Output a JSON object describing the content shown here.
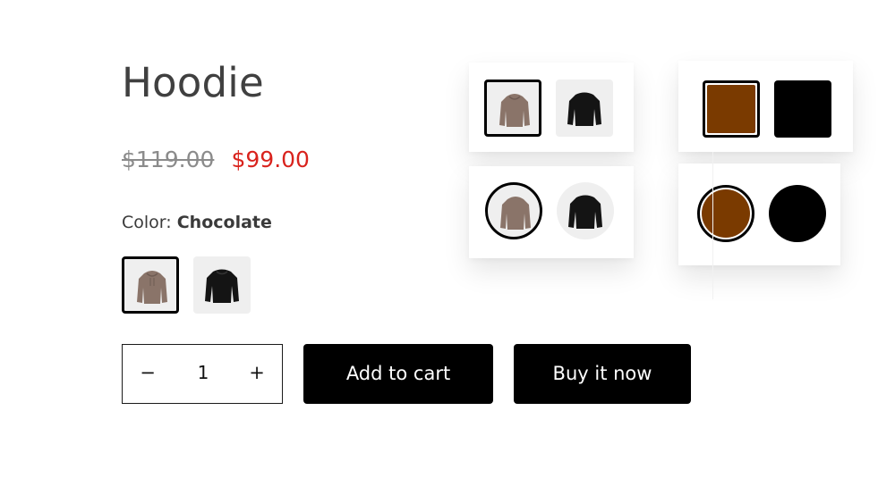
{
  "product": {
    "title": "Hoodie",
    "price_compare": "$119.00",
    "price_sale": "$99.00",
    "color_label": "Color:",
    "color_value": "Chocolate"
  },
  "variants": [
    {
      "name": "Chocolate",
      "icon": "brown-hoodie-icon",
      "swatch_color": "#7a3a00",
      "selected": true
    },
    {
      "name": "Black",
      "icon": "black-hoodie-icon",
      "swatch_color": "#000000",
      "selected": false
    }
  ],
  "quantity": {
    "minus": "−",
    "value": "1",
    "plus": "+"
  },
  "buttons": {
    "add_to_cart": "Add to cart",
    "buy_now": "Buy it now"
  },
  "colors": {
    "sale_price": "#d9231d",
    "button_bg": "#000000",
    "swatch_bg": "#efefef"
  }
}
